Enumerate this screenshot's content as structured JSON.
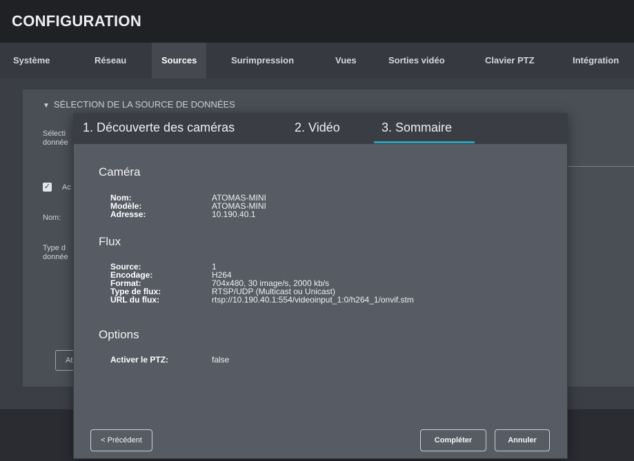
{
  "app": {
    "title": "CONFIGURATION"
  },
  "nav": {
    "tabs": [
      {
        "label": "Système"
      },
      {
        "label": "Réseau"
      },
      {
        "label": "Sources"
      },
      {
        "label": "Surimpression"
      },
      {
        "label": "Vues"
      },
      {
        "label": "Sorties vidéo"
      },
      {
        "label": "Clavier PTZ"
      },
      {
        "label": "Intégration"
      }
    ],
    "active": "Sources"
  },
  "background": {
    "section_title": "SÉLECTION DE LA SOURCE DE DONNÉES",
    "label_selection_1": "Sélecti",
    "label_selection_2": "donnée",
    "checkbox_label": "Ac",
    "label_name": "Nom:",
    "label_type_1": "Type d",
    "label_type_2": "donnée",
    "button_label": "At"
  },
  "wizard": {
    "steps": [
      {
        "label": "1. Découverte des caméras"
      },
      {
        "label": "2. Vidéo"
      },
      {
        "label": "3. Sommaire"
      }
    ],
    "active_step": 2,
    "camera": {
      "heading": "Caméra",
      "name_key": "Nom:",
      "name_value": "ATOMAS-MINI",
      "model_key": "Modèle:",
      "model_value": "ATOMAS-MINI",
      "address_key": "Adresse:",
      "address_value": "10.190.40.1"
    },
    "stream": {
      "heading": "Flux",
      "source_key": "Source:",
      "source_value": "1",
      "encoding_key": "Encodage:",
      "encoding_value": "H264",
      "format_key": "Format:",
      "format_value": "704x480, 30 image/s, 2000 kb/s",
      "type_key": "Type de flux:",
      "type_value": "RTSP/UDP (Multicast ou Unicast)",
      "url_key": "URL du flux:",
      "url_value": "rtsp://10.190.40.1:554/videoinput_1:0/h264_1/onvif.stm"
    },
    "options": {
      "heading": "Options",
      "ptz_key": "Activer le PTZ:",
      "ptz_value": "false"
    },
    "buttons": {
      "previous": "< Précédent",
      "complete": "Compléter",
      "cancel": "Annuler"
    }
  },
  "colors": {
    "accent": "#2aa3b6",
    "modal_bg": "#575b63",
    "header_bg": "#3a3d43"
  }
}
